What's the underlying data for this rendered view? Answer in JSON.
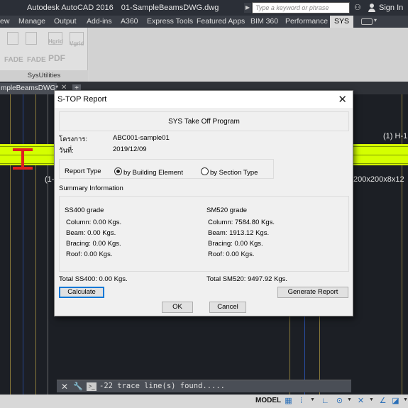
{
  "app": {
    "title": "Autodesk AutoCAD 2016",
    "filename": "01-SampleBeamsDWG.dwg",
    "search_placeholder": "Type a keyword or phrase",
    "sign_in": "Sign In"
  },
  "ribbon_tabs": [
    "ew",
    "Manage",
    "Output",
    "Add-ins",
    "A360",
    "Express Tools",
    "Featured Apps",
    "BIM 360",
    "Performance",
    "SYS"
  ],
  "active_tab": "SYS",
  "ribbon_panel": {
    "buttons": [
      "FADE",
      "FADE",
      "PDF",
      "Hgrid",
      "Vgrid"
    ],
    "label": "SysUtilities"
  },
  "doc_tab": "mpleBeamsDWG*",
  "drawing_texts": {
    "section_label": "(1) H-1",
    "section_size": "200x200x8x12",
    "left_label": "(1-"
  },
  "command_line": {
    "text": "-22 trace line(s) found....."
  },
  "status_bar": {
    "model": "MODEL"
  },
  "dialog": {
    "title": "S-TOP Report",
    "header": "SYS Take Off Program",
    "project_label": "โครงการ:",
    "project_value": "ABC001-sample01",
    "date_label": "วันที่:",
    "date_value": "2019/12/09",
    "report_type_label": "Report Type",
    "radio_building": "by Building Element",
    "radio_section": "by Section Type",
    "radio_selected": "building",
    "summary_label": "Summary Information",
    "ss400": {
      "grade": "SS400 grade",
      "column": "Column: 0.00 Kgs.",
      "beam": "Beam: 0.00 Kgs.",
      "bracing": "Bracing: 0.00 Kgs.",
      "roof": "Roof: 0.00 Kgs.",
      "total": "Total SS400: 0.00 Kgs."
    },
    "sm520": {
      "grade": "SM520 grade",
      "column": "Column: 7584.80 Kgs.",
      "beam": "Beam: 1913.12 Kgs.",
      "bracing": "Bracing: 0.00 Kgs.",
      "roof": "Roof: 0.00 Kgs.",
      "total": "Total SM520: 9497.92 Kgs."
    },
    "calculate": "Calculate",
    "generate_report": "Generate Report",
    "ok": "OK",
    "cancel": "Cancel"
  }
}
